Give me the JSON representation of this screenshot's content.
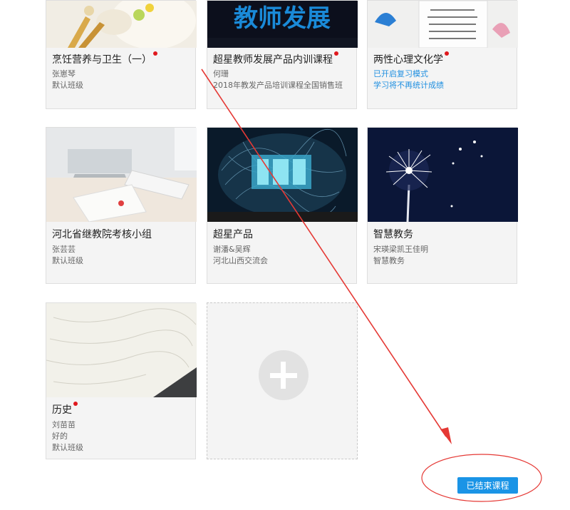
{
  "courses": [
    {
      "title": "烹饪营养与卫生（一）",
      "line1": "张崽琴",
      "line2": "默认班级",
      "line3": "",
      "new": true
    },
    {
      "title": "超星教师发展产品内训课程",
      "line1": "何珊",
      "line2": "2018年教发产品培训课程全国销售班",
      "line3": "",
      "new": true,
      "thumb_text": "教师发展"
    },
    {
      "title": "两性心理文化学",
      "line1": "已开启复习模式",
      "line2": "学习将不再统计成绩",
      "line3": "",
      "new": true
    },
    {
      "title": "河北省继教院考核小组",
      "line1": "张芸芸",
      "line2": "默认班级",
      "line3": "",
      "new": false
    },
    {
      "title": "超星产品",
      "line1": "谢潘&吴辉",
      "line2": "河北山西交流会",
      "line3": "",
      "new": false
    },
    {
      "title": "智慧教务",
      "line1": "宋瑛梁凯王佳明",
      "line2": "智慧教务",
      "line3": "",
      "new": false
    },
    {
      "title": "历史",
      "line1": "刘苗苗",
      "line2": "好的",
      "line3": "默认班级",
      "new": true
    }
  ],
  "ended_button": "已结束课程",
  "colors": {
    "accent": "#1a94e6",
    "annotation": "#e53935",
    "new_dot": "#e0191e"
  }
}
